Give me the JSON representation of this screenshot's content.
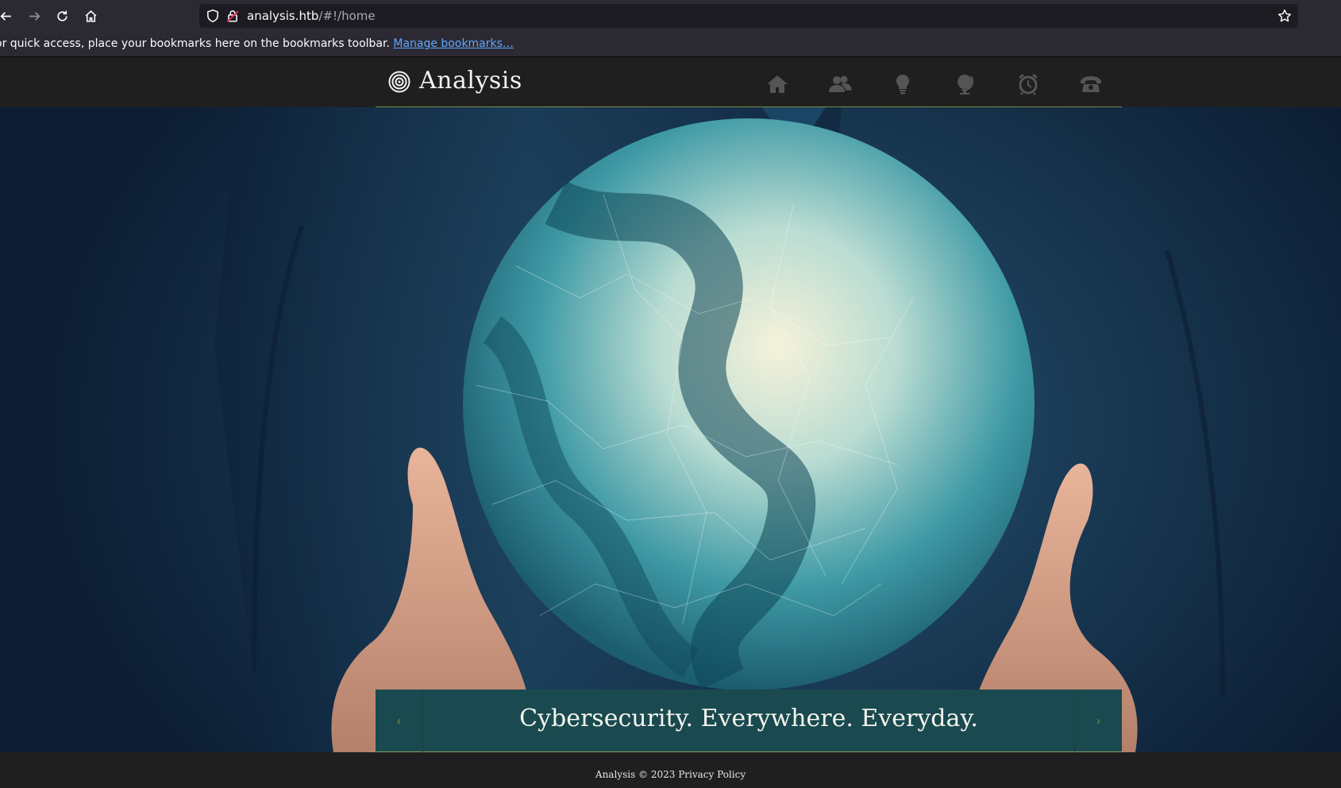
{
  "browser": {
    "url_host": "analysis.htb",
    "url_path": "/#!/home",
    "bookmarks_message": "or quick access, place your bookmarks here on the bookmarks toolbar.",
    "bookmarks_link": "Manage bookmarks…"
  },
  "site": {
    "brand": "Analysis",
    "nav": [
      {
        "icon": "home-icon"
      },
      {
        "icon": "users-icon"
      },
      {
        "icon": "lightbulb-icon"
      },
      {
        "icon": "globe-icon"
      },
      {
        "icon": "alarm-clock-icon"
      },
      {
        "icon": "phone-icon"
      }
    ],
    "colors": {
      "accent": "#7d8a3e",
      "caption_bg": "#1a4a4f",
      "header_bg": "#1f1f1f"
    }
  },
  "hero": {
    "caption": "Cybersecurity. Everywhere. Everyday.",
    "prev_label": "‹",
    "next_label": "›"
  },
  "footer": {
    "text": "Analysis © 2023 Privacy Policy"
  }
}
